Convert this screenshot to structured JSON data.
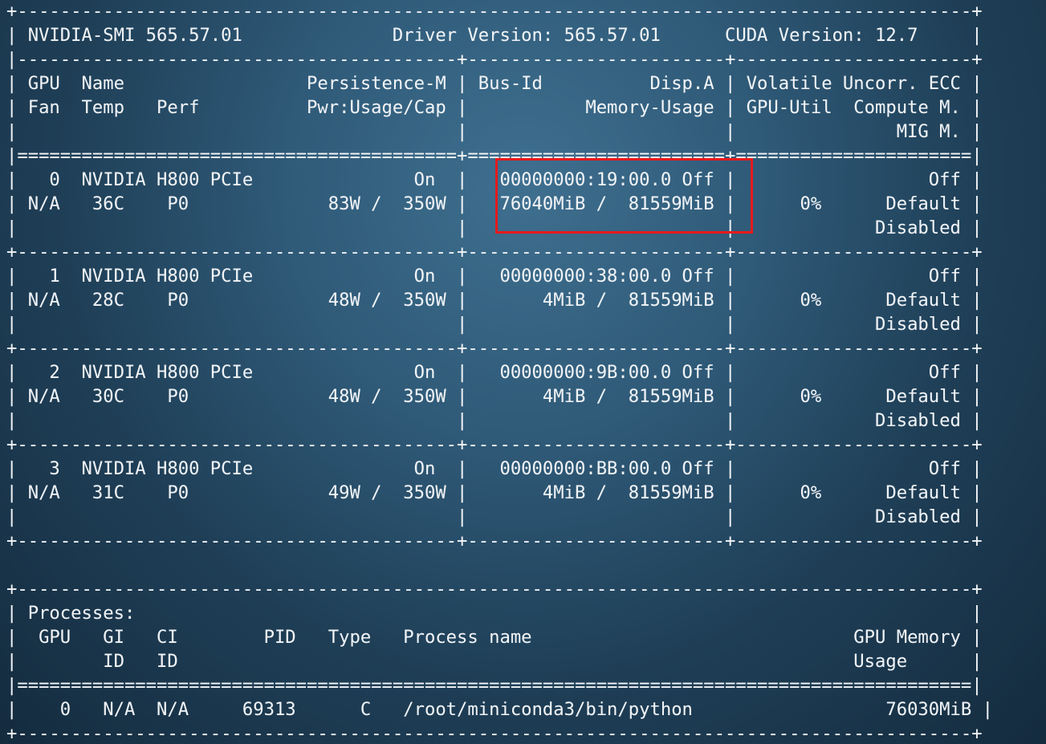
{
  "terminal": {
    "lines": [
      "+-----------------------------------------------------------------------------------------+",
      "| NVIDIA-SMI 565.57.01              Driver Version: 565.57.01      CUDA Version: 12.7     |",
      "|-----------------------------------------+------------------------+----------------------+",
      "| GPU  Name                 Persistence-M | Bus-Id          Disp.A | Volatile Uncorr. ECC |",
      "| Fan  Temp   Perf          Pwr:Usage/Cap |           Memory-Usage | GPU-Util  Compute M. |",
      "|                                         |                        |               MIG M. |",
      "|=========================================+========================+======================|",
      "|   0  NVIDIA H800 PCIe               On  |   00000000:19:00.0 Off |                  Off |",
      "| N/A   36C    P0             83W /  350W |   76040MiB /  81559MiB |      0%      Default |",
      "|                                         |                        |             Disabled |",
      "+-----------------------------------------+------------------------+----------------------+",
      "|   1  NVIDIA H800 PCIe               On  |   00000000:38:00.0 Off |                  Off |",
      "| N/A   28C    P0             48W /  350W |       4MiB /  81559MiB |      0%      Default |",
      "|                                         |                        |             Disabled |",
      "+-----------------------------------------+------------------------+----------------------+",
      "|   2  NVIDIA H800 PCIe               On  |   00000000:9B:00.0 Off |                  Off |",
      "| N/A   30C    P0             48W /  350W |       4MiB /  81559MiB |      0%      Default |",
      "|                                         |                        |             Disabled |",
      "+-----------------------------------------+------------------------+----------------------+",
      "|   3  NVIDIA H800 PCIe               On  |   00000000:BB:00.0 Off |                  Off |",
      "| N/A   31C    P0             49W /  350W |       4MiB /  81559MiB |      0%      Default |",
      "|                                         |                        |             Disabled |",
      "+-----------------------------------------+------------------------+----------------------+",
      "",
      "+-----------------------------------------------------------------------------------------+",
      "| Processes:                                                                              |",
      "|  GPU   GI   CI        PID   Type   Process name                              GPU Memory |",
      "|        ID   ID                                                               Usage      |",
      "|=========================================================================================|",
      "|    0   N/A  N/A     69313      C   /root/miniconda3/bin/python                  76030MiB |",
      "+-----------------------------------------------------------------------------------------+"
    ]
  },
  "colors": {
    "text": "#f1f4f7",
    "highlight_border": "#e8191b"
  }
}
